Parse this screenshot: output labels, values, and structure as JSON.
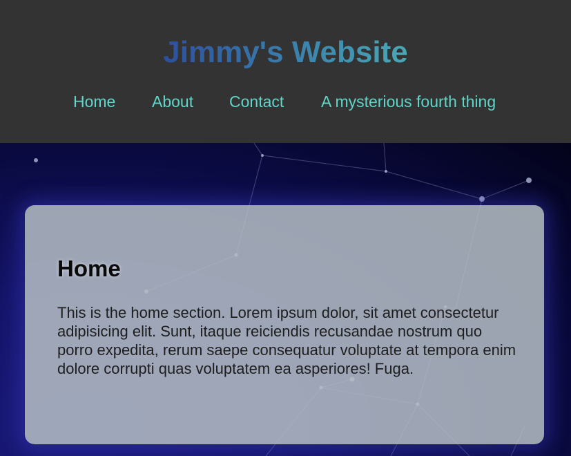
{
  "header": {
    "title": "Jimmy's Website",
    "title_gradient": [
      "#2e4f9c",
      "#3b82ad",
      "#4aa8b4"
    ],
    "background": "#333333"
  },
  "nav": {
    "link_color": "#5fd6c8",
    "items": [
      {
        "label": "Home"
      },
      {
        "label": "About"
      },
      {
        "label": "Contact"
      },
      {
        "label": "A mysterious fourth thing"
      }
    ]
  },
  "hero": {
    "background": "#141468"
  },
  "section": {
    "title": "Home",
    "body": "This is the home section. Lorem ipsum dolor, sit amet consectetur adipisicing elit. Sunt, itaque reiciendis recusandae nostrum quo porro expedita, rerum saepe consequatur voluptate at tempora enim dolore corrupti quas voluptatem ea asperiores! Fuga."
  }
}
